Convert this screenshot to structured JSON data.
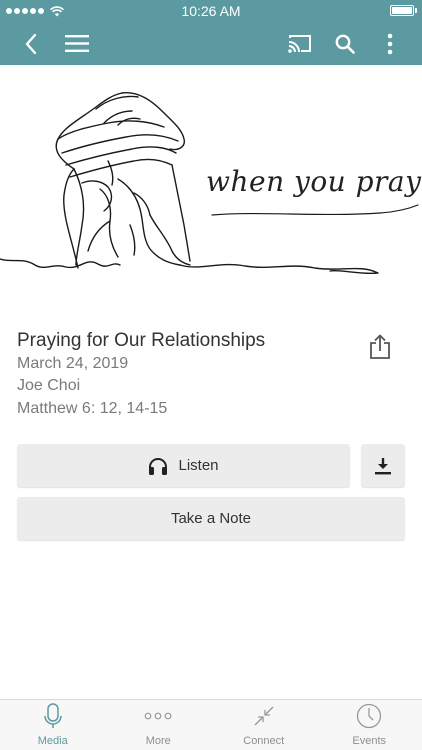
{
  "status_bar": {
    "time": "10:26 AM"
  },
  "nav": {
    "back_icon": "chevron-left-icon",
    "menu_icon": "hamburger-menu-icon",
    "cast_icon": "cast-icon",
    "search_icon": "search-icon",
    "more_icon": "vertical-ellipsis-icon"
  },
  "hero": {
    "script_text": "when you pray"
  },
  "sermon": {
    "title": "Praying for Our Relationships",
    "date": "March 24, 2019",
    "speaker": "Joe Choi",
    "scripture": "Matthew 6: 12, 14-15"
  },
  "actions": {
    "listen_label": "Listen",
    "note_label": "Take a Note"
  },
  "tabs": [
    {
      "label": "Media",
      "icon": "microphone-icon",
      "active": true
    },
    {
      "label": "More",
      "icon": "more-dots-icon",
      "active": false
    },
    {
      "label": "Connect",
      "icon": "connect-arrows-icon",
      "active": false
    },
    {
      "label": "Events",
      "icon": "clock-icon",
      "active": false
    }
  ],
  "colors": {
    "accent": "#5b9aa0",
    "tab_active": "#5b9aa0",
    "button_bg": "#ececec"
  }
}
